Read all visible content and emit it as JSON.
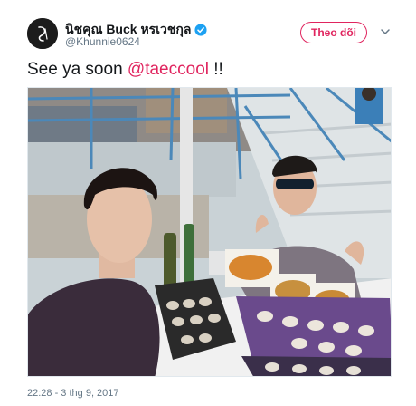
{
  "tweet": {
    "display_name": "นิชคุณ Buck หรเวชกุล",
    "handle": "@Khunnie0624",
    "verified": true,
    "follow_label": "Theo dõi",
    "text_prefix": "See ya soon ",
    "mention": "@taeccool",
    "text_suffix": " !!",
    "timestamp": "22:28 - 3 thg 9, 2017"
  },
  "colors": {
    "accent": "#e0245e",
    "verified_badge": "#1da1f2",
    "secondary_text": "#657786"
  },
  "icons": {
    "avatar": "profile-avatar",
    "verified": "verified-badge-icon",
    "caret": "chevron-down-icon"
  }
}
